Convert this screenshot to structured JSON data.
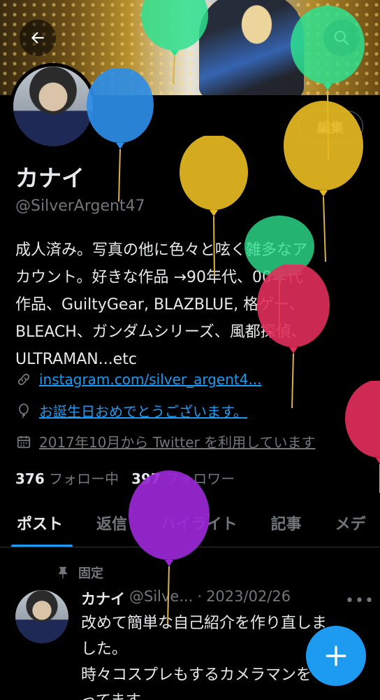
{
  "profile": {
    "display_name": "カナイ",
    "handle": "@SilverArgent47",
    "edit_label": "編集",
    "bio_lines": [
      "成人済み。写真の他に色々と呟く雑多なア",
      "カウント。好きな作品 →90年代、00年代",
      "作品、GuiltyGear, BLAZBLUE, 格ゲー、",
      "BLEACH、ガンダムシリーズ、風都探偵、",
      "ULTRAMAN...etc"
    ],
    "link_text": "instagram.com/silver_argent4...",
    "birthday_text": "お誕生日おめでとうございます。",
    "joined_text": "2017年10月から Twitter を利用しています",
    "following_count": "376",
    "following_label": "フォロー中",
    "followers_count": "397",
    "followers_label": "フォロワー"
  },
  "tabs": [
    {
      "label": "ポスト",
      "active": true
    },
    {
      "label": "返信"
    },
    {
      "label": "ハイライト"
    },
    {
      "label": "記事"
    },
    {
      "label": "メデ"
    }
  ],
  "pinned_tweet": {
    "pinned_label": "固定",
    "author_name": "カナイ",
    "author_handle": "@Silve...",
    "separator": "·",
    "date": "2023/02/26",
    "body_lines": [
      "改めて簡単な自己紹介を作り直しま",
      "した。",
      "時々コスプレもするカメラマンをや",
      "ってます。"
    ]
  },
  "icons": {
    "back": "back-arrow-icon",
    "search": "search-icon",
    "link": "link-icon",
    "birthday": "balloon-icon",
    "calendar": "calendar-icon",
    "pin": "pin-icon",
    "more": "more-icon",
    "compose": "plus-icon"
  },
  "colors": {
    "accent": "#1d9bf0",
    "background": "#000000",
    "text_primary": "#e7e9ea",
    "text_secondary": "#71767b",
    "border": "#2f3336"
  }
}
